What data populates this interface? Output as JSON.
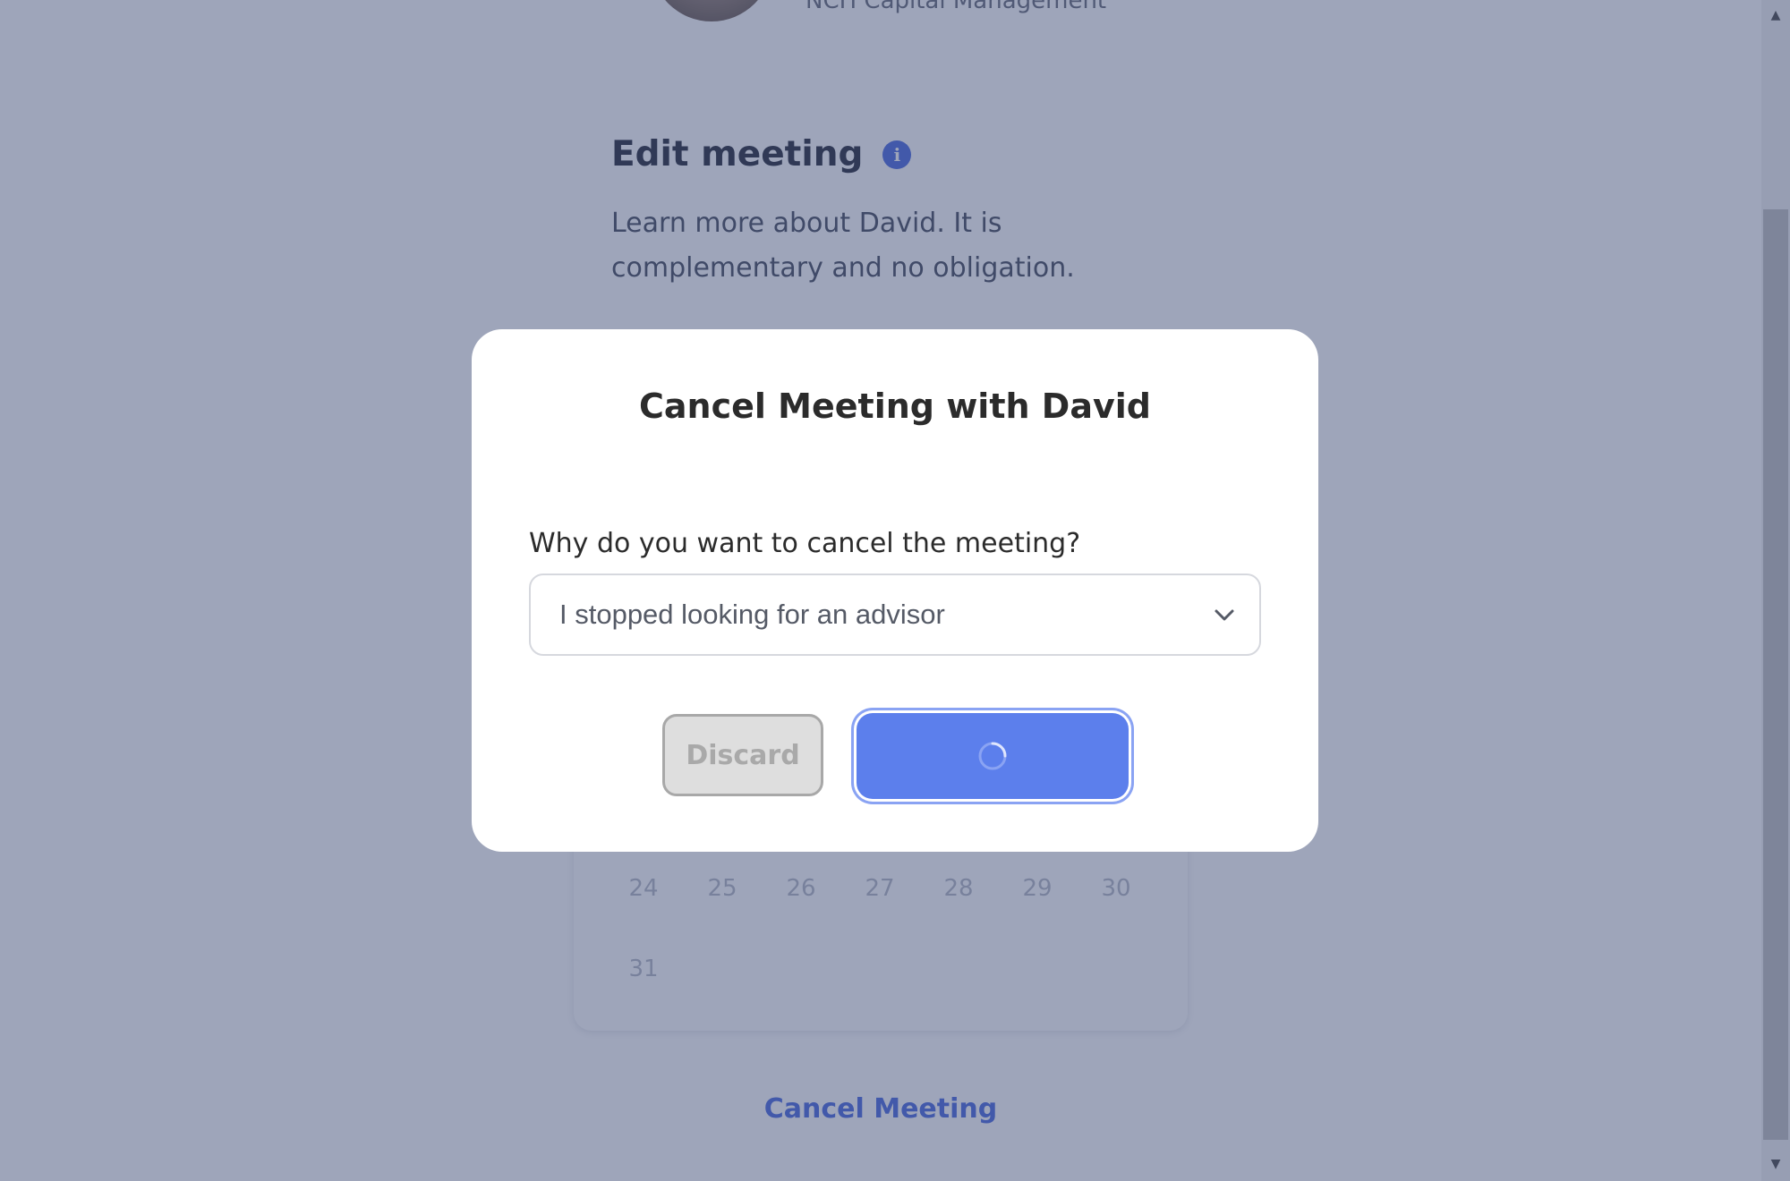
{
  "background": {
    "firm_name": "NCH Capital Management",
    "edit_title": "Edit meeting",
    "edit_description": "Learn more about David. It is complementary and no obligation.",
    "calendar_rows": [
      [
        "24",
        "25",
        "26",
        "27",
        "28",
        "29",
        "30"
      ],
      [
        "31"
      ]
    ],
    "cancel_link": "Cancel Meeting"
  },
  "modal": {
    "title": "Cancel Meeting with David",
    "question": "Why do you want to cancel the meeting?",
    "reason_selected": "I stopped looking for an advisor",
    "discard_label": "Discard",
    "confirm_state": "loading"
  },
  "colors": {
    "accent": "#5c7fec",
    "overlay": "#34426e"
  },
  "icons": {
    "info": "info-icon",
    "dropdown": "chevron-down-icon",
    "loading": "spinner-icon"
  }
}
